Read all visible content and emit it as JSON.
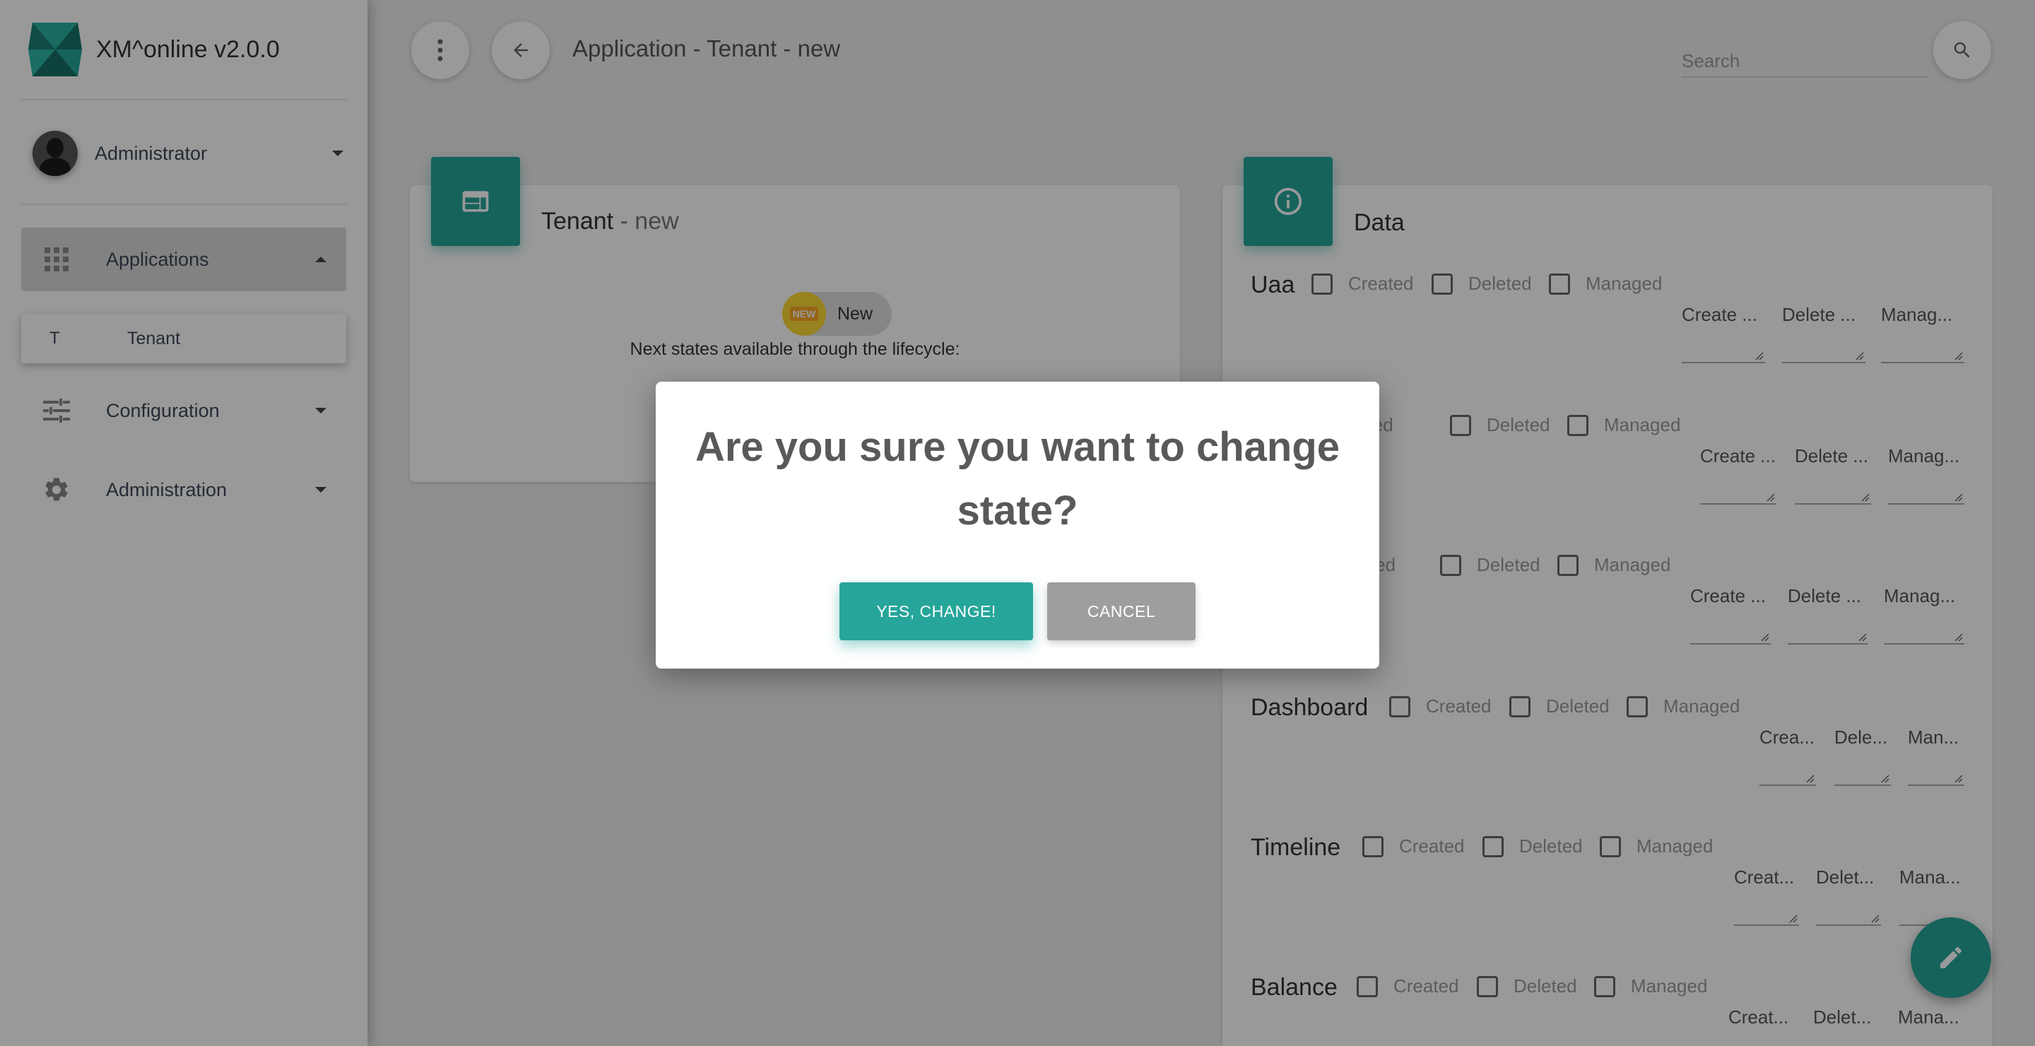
{
  "brand": {
    "name": "XM^online v2.0.0"
  },
  "user": {
    "name": "Administrator"
  },
  "sidebar": {
    "items": [
      {
        "label": "Applications",
        "icon": "apps-grid-icon"
      },
      {
        "label": "Configuration",
        "icon": "tune-sliders-icon"
      },
      {
        "label": "Administration",
        "icon": "gear-icon"
      }
    ],
    "subitems": [
      {
        "letter": "T",
        "label": "Tenant"
      }
    ]
  },
  "header": {
    "title": "Application - Tenant - new",
    "search_placeholder": "Search"
  },
  "tenant_card": {
    "title": "Tenant",
    "title_suffix": " - new",
    "state_chip": {
      "badge": "NEW",
      "label": "New"
    },
    "lifecycle_text": "Next states available through the lifecycle:"
  },
  "data_card": {
    "title": "Data",
    "rows": [
      {
        "name": "Uaa",
        "checkboxes": [
          "Created",
          "Deleted",
          "Managed"
        ],
        "fields": [
          "Create ...",
          "Delete ...",
          "Manag..."
        ]
      },
      {
        "name": "",
        "checkboxes": [
          "reated",
          "Deleted",
          "Managed"
        ],
        "fields": [
          "Create ...",
          "Delete ...",
          "Manag..."
        ]
      },
      {
        "name": "",
        "checkboxes": [
          "eated",
          "Deleted",
          "Managed"
        ],
        "fields": [
          "Create ...",
          "Delete ...",
          "Manag..."
        ]
      },
      {
        "name": "Dashboard",
        "checkboxes": [
          "Created",
          "Deleted",
          "Managed"
        ],
        "fields": [
          "Crea...",
          "Dele...",
          "Man..."
        ]
      },
      {
        "name": "Timeline",
        "checkboxes": [
          "Created",
          "Deleted",
          "Managed"
        ],
        "fields": [
          "Creat...",
          "Delet...",
          "Mana..."
        ]
      },
      {
        "name": "Balance",
        "checkboxes": [
          "Created",
          "Deleted",
          "Managed"
        ],
        "fields": [
          "Creat...",
          "Delet...",
          "Mana..."
        ]
      }
    ]
  },
  "dialog": {
    "title": "Are you sure you want to change state?",
    "confirm_label": "YES, CHANGE!",
    "cancel_label": "CANCEL"
  },
  "colors": {
    "accent": "#26a69a",
    "chip_badge": "#fdd835",
    "overlay": "rgba(0,0,0,0.4)"
  }
}
